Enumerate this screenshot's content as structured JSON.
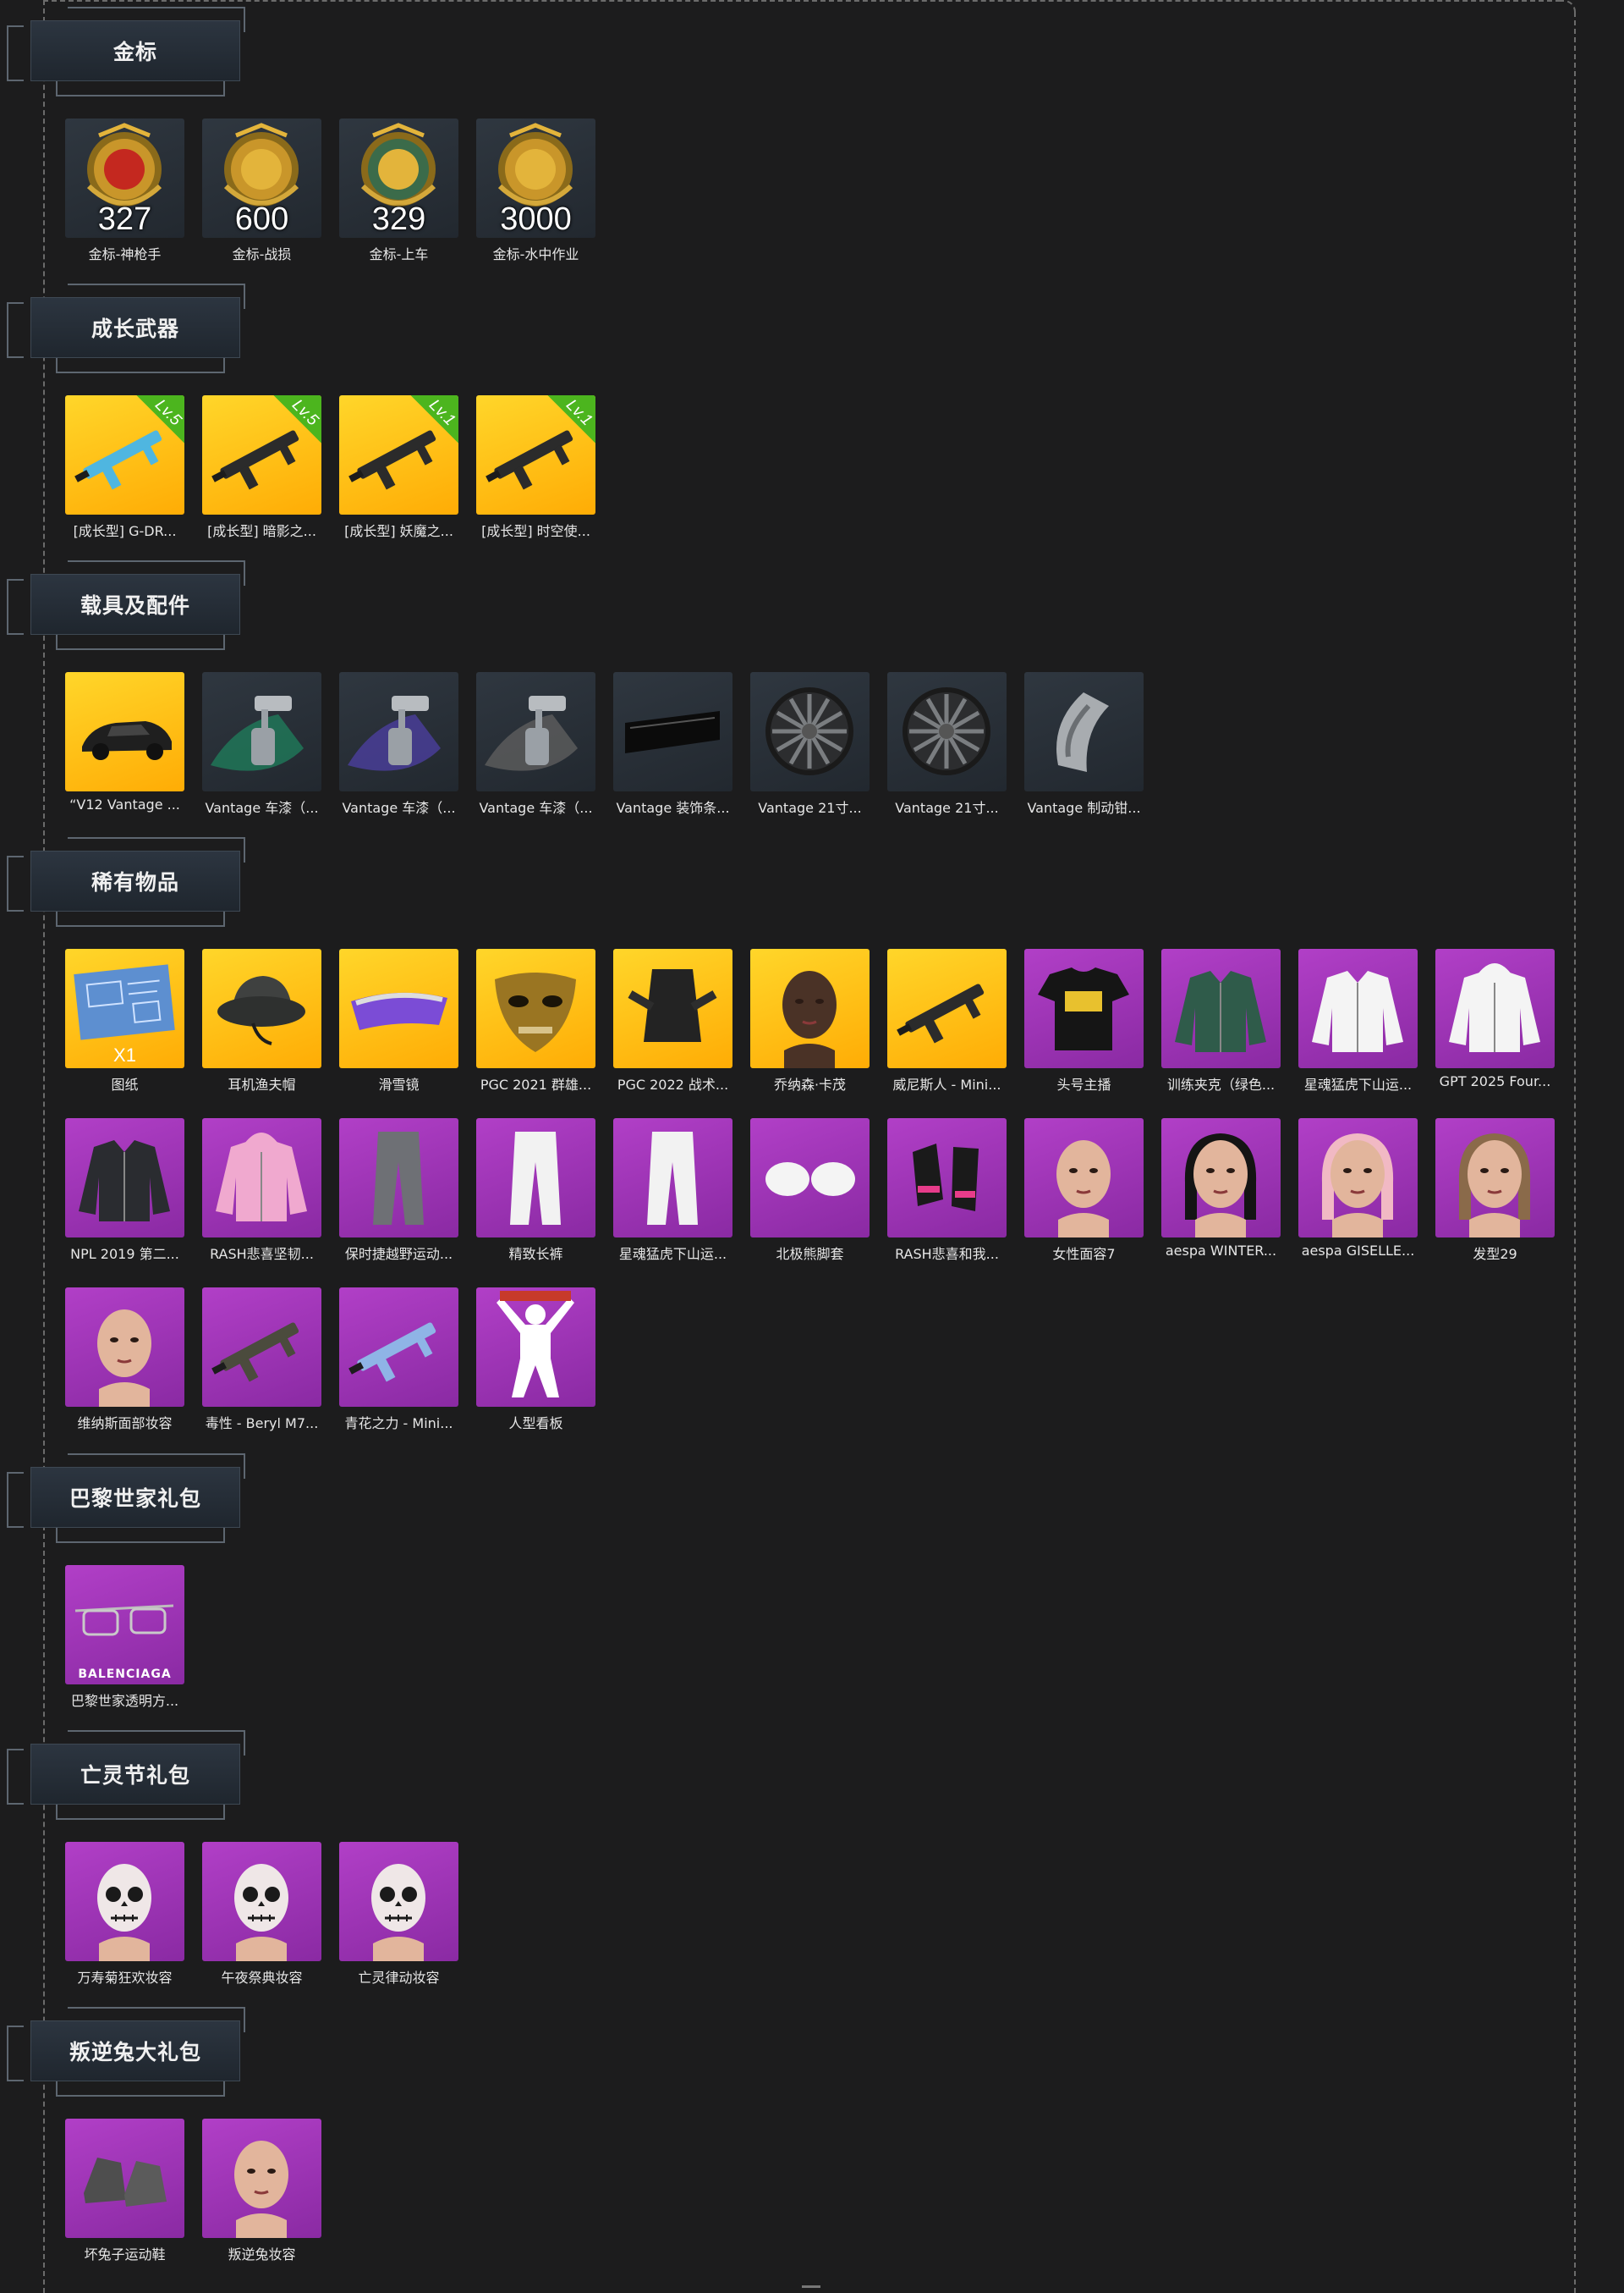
{
  "sections": [
    {
      "title": "金标",
      "items": [
        {
          "name": "金标-神枪手",
          "count": "327",
          "bg": "dark",
          "icon": "sharpshooter-medal-icon"
        },
        {
          "name": "金标-战损",
          "count": "600",
          "bg": "dark",
          "icon": "soldier-medal-icon"
        },
        {
          "name": "金标-上车",
          "count": "329",
          "bg": "dark",
          "icon": "car-medal-icon"
        },
        {
          "name": "金标-水中作业",
          "count": "3000",
          "bg": "dark",
          "icon": "seal-medal-icon"
        }
      ]
    },
    {
      "title": "成长武器",
      "items": [
        {
          "name": "[成长型] G-DR...",
          "level": "Lv.5",
          "bg": "gold",
          "icon": "smg-weapon-icon"
        },
        {
          "name": "[成长型] 暗影之...",
          "level": "Lv.5",
          "bg": "gold",
          "icon": "rifle-weapon-icon"
        },
        {
          "name": "[成长型] 妖魔之...",
          "level": "Lv.1",
          "bg": "gold",
          "icon": "assault-rifle-icon"
        },
        {
          "name": "[成长型] 时空使...",
          "level": "Lv.1",
          "bg": "gold",
          "icon": "drum-rifle-icon"
        }
      ]
    },
    {
      "title": "载具及配件",
      "items": [
        {
          "name": "“V12 Vantage ...",
          "bg": "gold",
          "icon": "sports-car-icon"
        },
        {
          "name": "Vantage 车漆（...",
          "bg": "dark",
          "icon": "paint-sprayer-green-icon"
        },
        {
          "name": "Vantage 车漆（...",
          "bg": "dark",
          "icon": "paint-sprayer-blue-icon"
        },
        {
          "name": "Vantage 车漆（...",
          "bg": "dark",
          "icon": "paint-sprayer-gray-icon"
        },
        {
          "name": "Vantage 装饰条...",
          "bg": "dark",
          "icon": "trim-strip-icon"
        },
        {
          "name": "Vantage 21寸...",
          "bg": "dark",
          "icon": "wheel-rim-icon"
        },
        {
          "name": "Vantage 21寸...",
          "bg": "dark",
          "icon": "wheel-rim-icon"
        },
        {
          "name": "Vantage 制动钳...",
          "bg": "dark",
          "icon": "brake-caliper-icon"
        }
      ]
    },
    {
      "title": "稀有物品",
      "items": [
        {
          "name": "图纸",
          "qty": "X1",
          "bg": "gold",
          "icon": "blueprint-icon"
        },
        {
          "name": "耳机渔夫帽",
          "bg": "gold",
          "icon": "bucket-hat-icon"
        },
        {
          "name": "滑雪镜",
          "bg": "gold",
          "icon": "ski-goggles-icon"
        },
        {
          "name": "PGC 2021 群雄...",
          "bg": "gold",
          "icon": "gold-mask-icon"
        },
        {
          "name": "PGC 2022 战术...",
          "bg": "gold",
          "icon": "tactical-vest-icon"
        },
        {
          "name": "乔纳森·卡茂",
          "bg": "gold",
          "icon": "male-face-icon"
        },
        {
          "name": "威尼斯人 - Mini...",
          "bg": "gold",
          "icon": "rifle-skin-icon"
        },
        {
          "name": "头号主播",
          "bg": "purple",
          "icon": "tshirt-icon"
        },
        {
          "name": "训练夹克（绿色...",
          "bg": "purple",
          "icon": "green-jacket-icon"
        },
        {
          "name": "星魂猛虎下山运...",
          "bg": "purple",
          "icon": "white-jacket-icon"
        },
        {
          "name": "GPT 2025 Four...",
          "bg": "purple",
          "icon": "hooded-jacket-icon"
        },
        {
          "name": "NPL 2019 第二...",
          "bg": "purple",
          "icon": "npl-jacket-icon"
        },
        {
          "name": "RASH悲喜坚韧...",
          "bg": "purple",
          "icon": "pink-hoodie-icon"
        },
        {
          "name": "保时捷越野运动...",
          "bg": "purple",
          "icon": "gray-pants-icon"
        },
        {
          "name": "精致长裤",
          "bg": "purple",
          "icon": "white-pants-icon"
        },
        {
          "name": "星魂猛虎下山运...",
          "bg": "purple",
          "icon": "white-pants-icon"
        },
        {
          "name": "北极熊脚套",
          "bg": "purple",
          "icon": "bear-paws-icon"
        },
        {
          "name": "RASH悲喜和我...",
          "bg": "purple",
          "icon": "gloves-icon"
        },
        {
          "name": "女性面容7",
          "bg": "purple",
          "icon": "female-face-icon"
        },
        {
          "name": "aespa WINTER...",
          "bg": "purple",
          "icon": "black-hair-face-icon"
        },
        {
          "name": "aespa GISELLE...",
          "bg": "purple",
          "icon": "pink-hair-face-icon"
        },
        {
          "name": "发型29",
          "bg": "purple",
          "icon": "ponytail-hair-icon"
        },
        {
          "name": "维纳斯面部妆容",
          "bg": "purple",
          "icon": "makeup-face-icon"
        },
        {
          "name": "毒性 - Beryl M7...",
          "bg": "purple",
          "icon": "beryl-rifle-icon"
        },
        {
          "name": "青花之力 - Mini...",
          "bg": "purple",
          "icon": "porcelain-rifle-icon"
        },
        {
          "name": "人型看板",
          "bg": "purple",
          "icon": "human-sign-icon"
        }
      ]
    },
    {
      "title": "巴黎世家礼包",
      "items": [
        {
          "name": "巴黎世家透明方...",
          "brand": "BALENCIAGA",
          "bg": "purple",
          "icon": "sunglasses-icon"
        }
      ]
    },
    {
      "title": "亡灵节礼包",
      "items": [
        {
          "name": "万寿菊狂欢妆容",
          "bg": "purple",
          "icon": "skull-makeup-icon"
        },
        {
          "name": "午夜祭典妆容",
          "bg": "purple",
          "icon": "skull-makeup-icon"
        },
        {
          "name": "亡灵律动妆容",
          "bg": "purple",
          "icon": "skull-makeup-icon"
        }
      ]
    },
    {
      "title": "叛逆兔大礼包",
      "items": [
        {
          "name": "坏兔子运动鞋",
          "bg": "purple",
          "icon": "sneakers-icon"
        },
        {
          "name": "叛逆兔妆容",
          "bg": "purple",
          "icon": "bald-face-icon"
        }
      ]
    }
  ],
  "colors": {
    "background": "#1c1c1d",
    "gold_tile": "#ffc316",
    "purple_tile": "#a035b8",
    "dark_tile": "#2a3139",
    "level_flag": "#4cb51e"
  }
}
